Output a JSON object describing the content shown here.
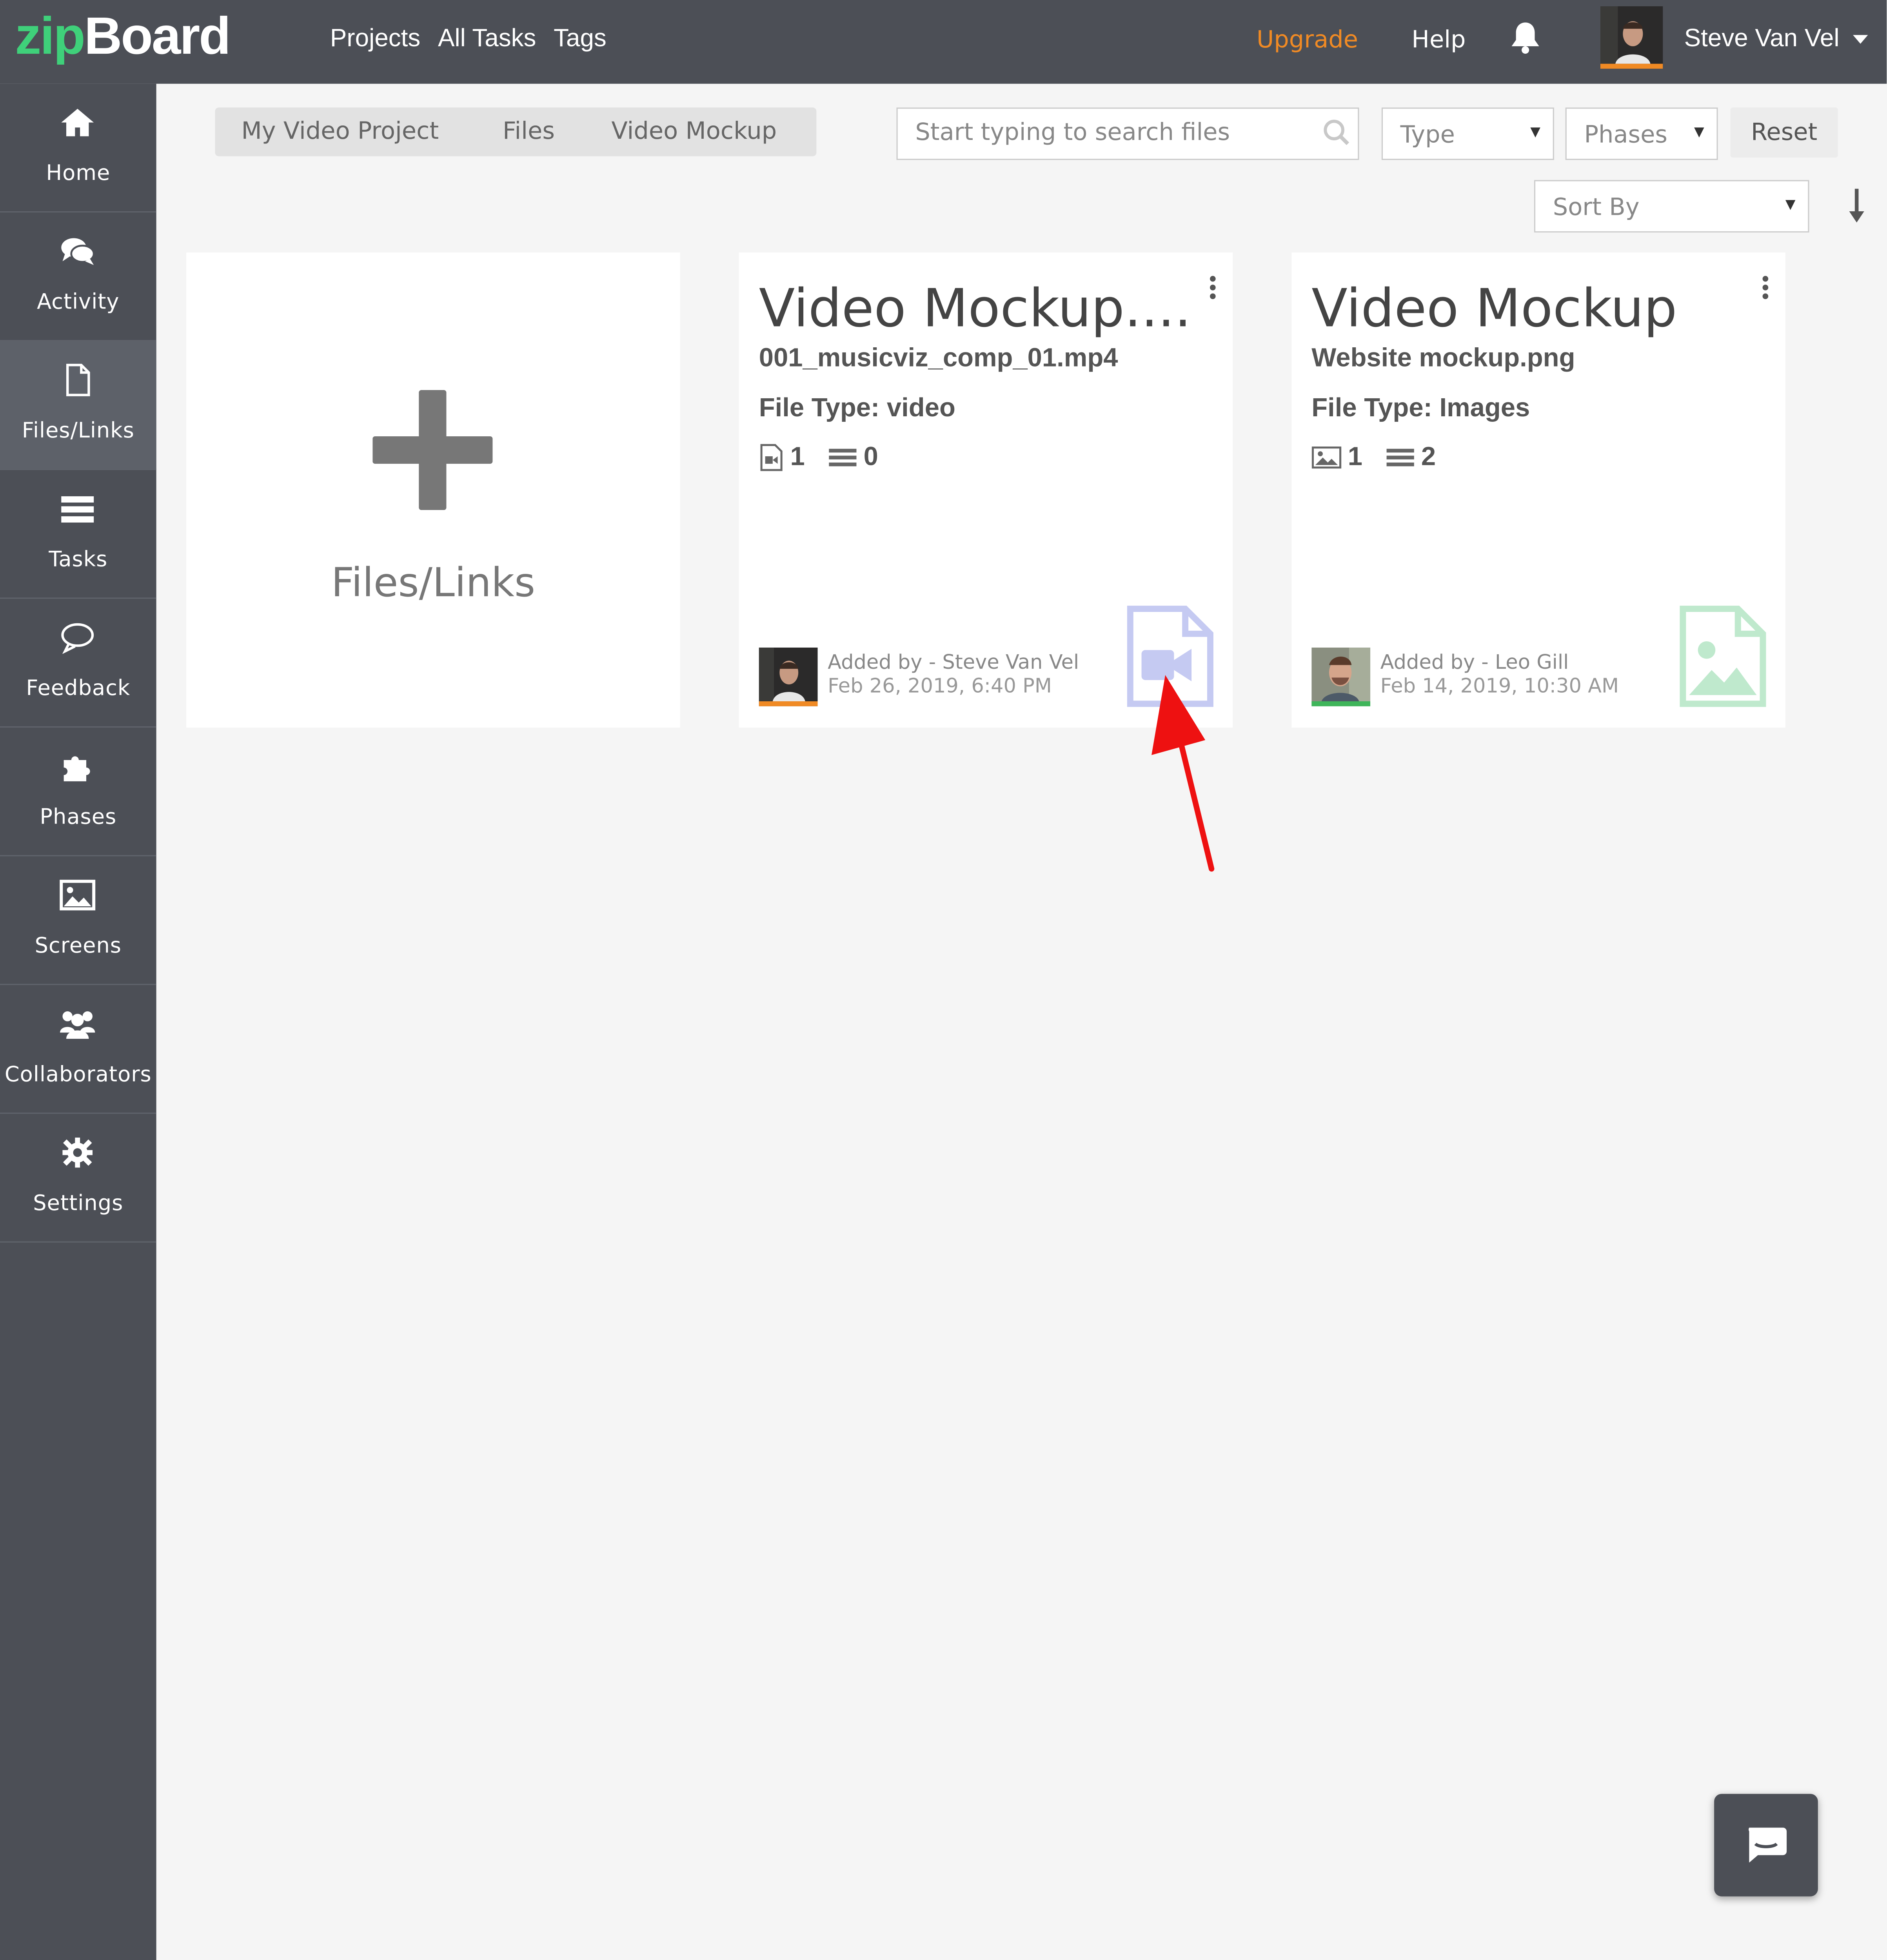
{
  "app": {
    "logo_part1": "zip",
    "logo_part2": "Board"
  },
  "topnav": {
    "projects": "Projects",
    "all_tasks": "All Tasks",
    "tags": "Tags"
  },
  "header": {
    "upgrade": "Upgrade",
    "help": "Help",
    "user_name": "Steve Van Vel"
  },
  "sidebar": {
    "items": [
      {
        "label": "Home",
        "icon": "home-icon"
      },
      {
        "label": "Activity",
        "icon": "comments-icon"
      },
      {
        "label": "Files/Links",
        "icon": "file-icon",
        "active": true
      },
      {
        "label": "Tasks",
        "icon": "tasks-icon"
      },
      {
        "label": "Feedback",
        "icon": "chat-bubble-icon"
      },
      {
        "label": "Phases",
        "icon": "puzzle-icon"
      },
      {
        "label": "Screens",
        "icon": "image-icon"
      },
      {
        "label": "Collaborators",
        "icon": "users-icon"
      },
      {
        "label": "Settings",
        "icon": "gear-icon"
      }
    ]
  },
  "breadcrumb": [
    "My Video Project",
    "Files",
    "Video Mockup"
  ],
  "filters": {
    "search_placeholder": "Start typing to search files",
    "type": "Type",
    "phases": "Phases",
    "reset": "Reset",
    "sort_by": "Sort By"
  },
  "add_card": {
    "label": "Files/Links"
  },
  "cards": [
    {
      "title": "Video Mockup....",
      "file_name": "001_musicviz_comp_01.mp4",
      "file_type": "File Type: video",
      "versions": "1",
      "tasks": "0",
      "added_by": "Added by - Steve Van Vel",
      "date": "Feb 26, 2019, 6:40 PM",
      "avatar_accent": "#f08a24",
      "file_icon_color": "#c5caf2"
    },
    {
      "title": "Video Mockup",
      "file_name": "Website mockup.png",
      "file_type": "File Type: Images",
      "versions": "1",
      "tasks": "2",
      "added_by": "Added by - Leo Gill",
      "date": "Feb 14, 2019, 10:30 AM",
      "avatar_accent": "#3fb55a",
      "file_icon_color": "#bfe9cd"
    }
  ],
  "colors": {
    "topbar": "#4c4f56",
    "sidebar": "#4c4f56",
    "sidebar_active": "#5d6169",
    "logo_accent": "#3fd07a",
    "upgrade": "#f08a24",
    "annotation_arrow": "#ee1111",
    "background": "#f5f5f5"
  }
}
